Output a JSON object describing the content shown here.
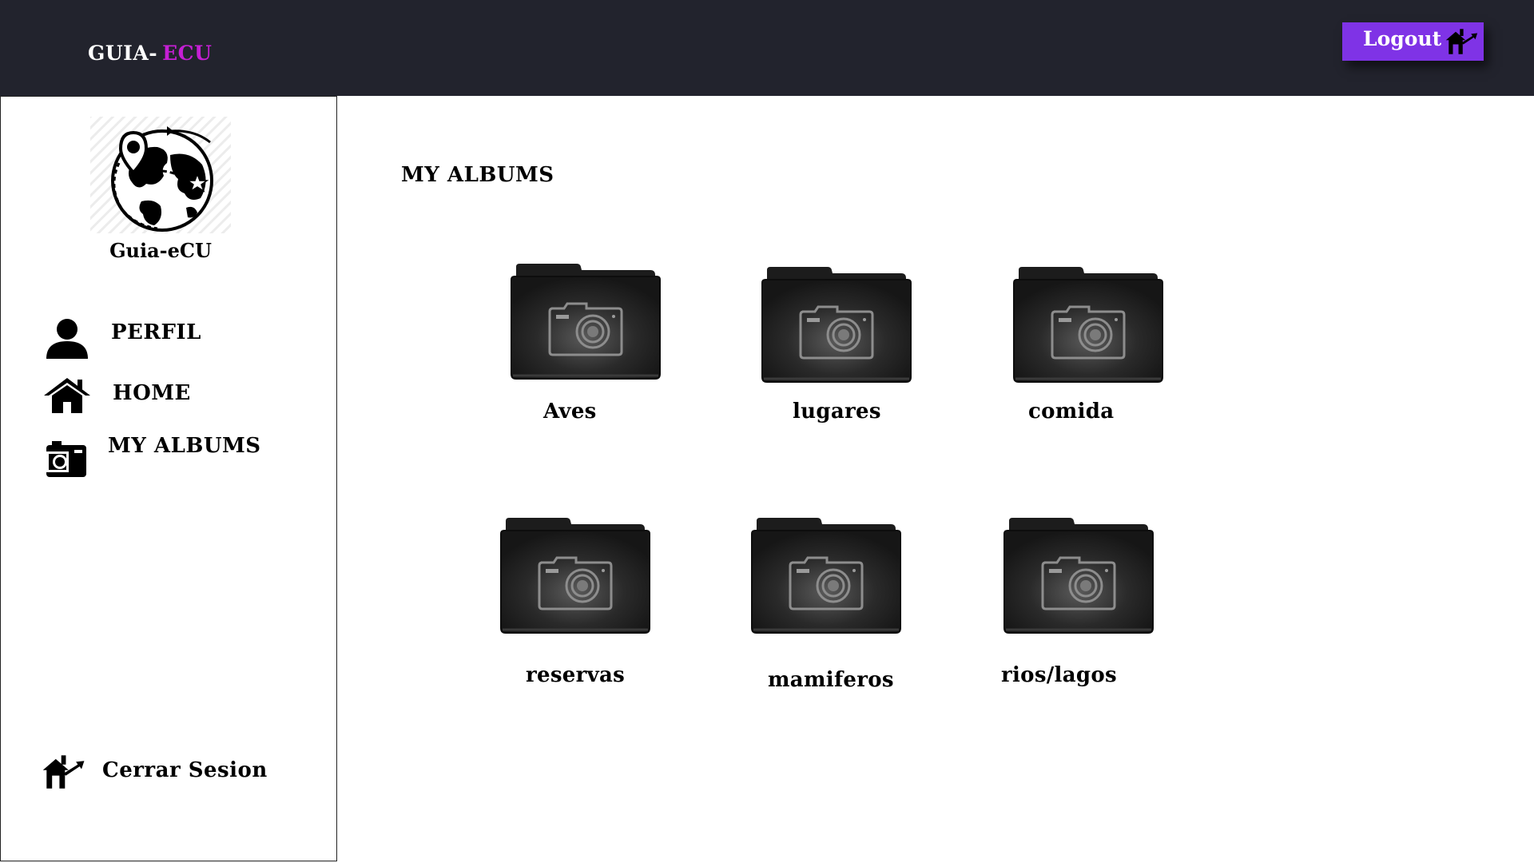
{
  "header": {
    "brand_part1": "GUIA-",
    "brand_part2": "ECU",
    "logout_label": "Logout"
  },
  "sidebar": {
    "logo_text": "Guia-eCU",
    "items": [
      {
        "label": "PERFIL",
        "icon": "user-icon"
      },
      {
        "label": "HOME",
        "icon": "house-icon"
      },
      {
        "label": "MY ALBUMS",
        "icon": "camera-icon"
      }
    ],
    "logout_label": "Cerrar Sesion"
  },
  "main": {
    "title": "MY ALBUMS",
    "albums": [
      {
        "label": "Aves",
        "icon": "camera-folder-icon"
      },
      {
        "label": "lugares",
        "icon": "camera-folder-icon"
      },
      {
        "label": "comida",
        "icon": "camera-folder-icon"
      },
      {
        "label": "reservas",
        "icon": "camera-folder-icon"
      },
      {
        "label": "mamiferos",
        "icon": "camera-folder-icon"
      },
      {
        "label": "rios/lagos",
        "icon": "camera-folder-icon"
      }
    ]
  },
  "colors": {
    "topbar": "#22232d",
    "brand_accent": "#c51fd4",
    "logout_button": "#7f33e6"
  }
}
